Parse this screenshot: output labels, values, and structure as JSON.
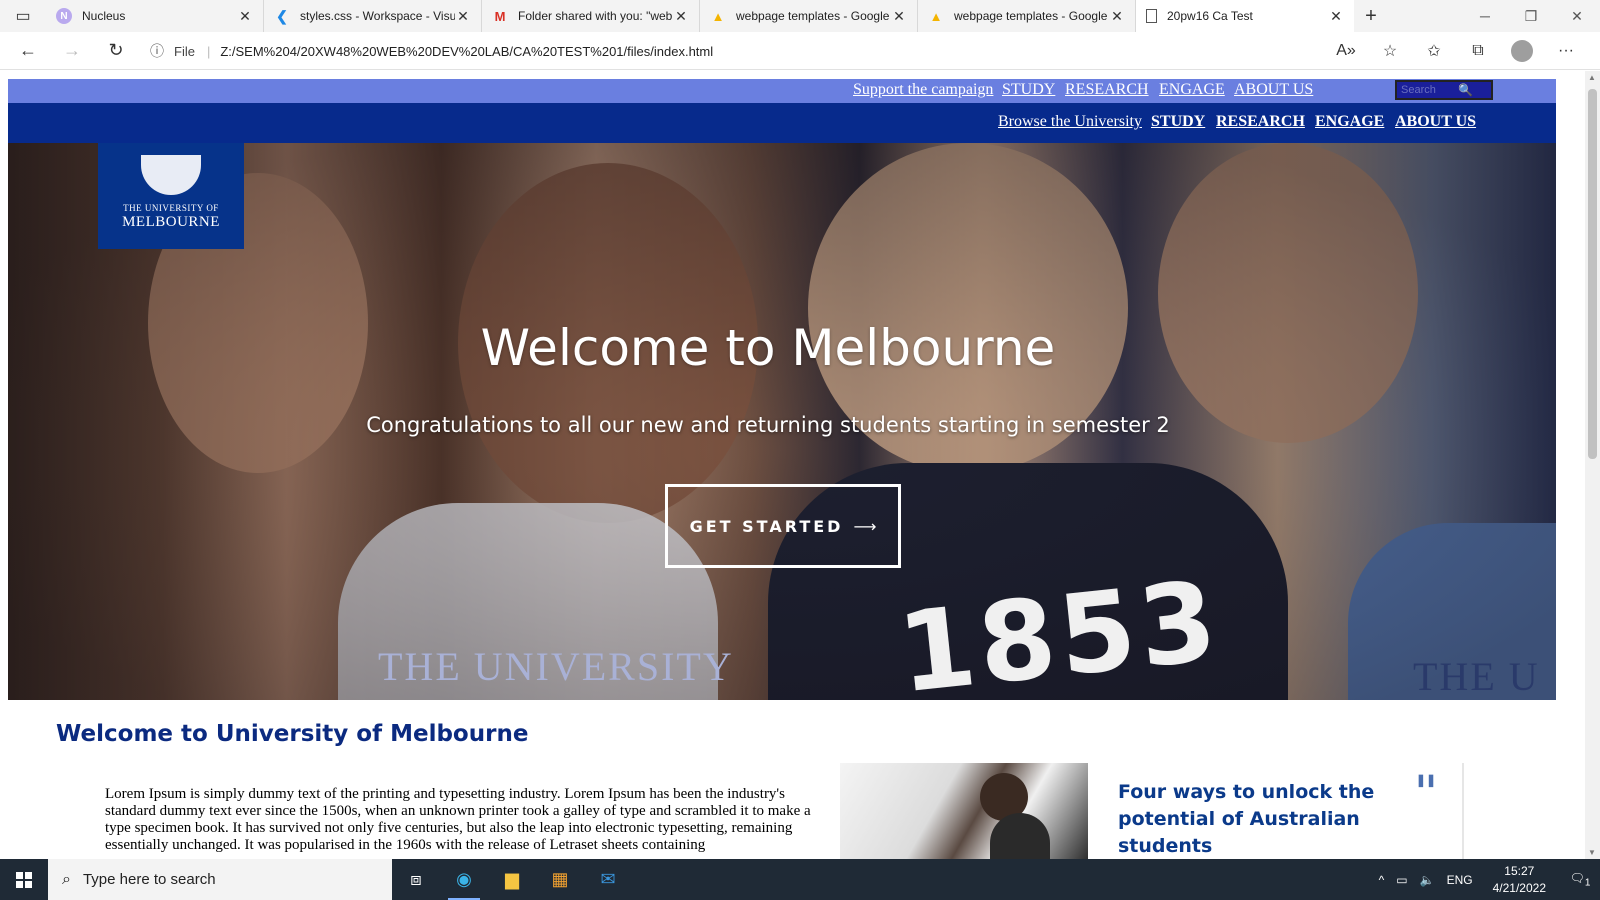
{
  "browser": {
    "tabs": [
      {
        "title": "Nucleus",
        "favicon": "N",
        "active": false
      },
      {
        "title": "styles.css - Workspace - Visua",
        "favicon": "vscode",
        "active": false
      },
      {
        "title": "Folder shared with you: \"web",
        "favicon": "M",
        "active": false
      },
      {
        "title": "webpage templates - Google",
        "favicon": "drive",
        "active": false
      },
      {
        "title": "webpage templates - Google",
        "favicon": "drive",
        "active": false
      },
      {
        "title": "20pw16 Ca Test",
        "favicon": "page",
        "active": true
      }
    ],
    "address": {
      "scheme_label": "File",
      "url": "Z:/SEM%204/20XW48%20WEB%20DEV%20LAB/CA%20TEST%201/files/index.html"
    }
  },
  "page": {
    "topnav": {
      "links": [
        "Support the campaign",
        "STUDY",
        "RESEARCH",
        "ENGAGE",
        "ABOUT US"
      ],
      "search_placeholder": "Search"
    },
    "mainnav": {
      "links": [
        "Browse the University",
        "STUDY",
        "RESEARCH",
        "ENGAGE",
        "ABOUT US"
      ]
    },
    "hero": {
      "logo_line1": "THE UNIVERSITY OF",
      "logo_line2": "MELBOURNE",
      "title": "Welcome to Melbourne",
      "subtitle": "Congratulations to all our new and returning students starting in semester 2",
      "cta": "GET STARTED",
      "cta_arrow": "⟶",
      "shirt_text_left": "THE UNIVERSITY",
      "shirt_text_right": "THE U",
      "shirt_number": "1853"
    },
    "welcome_heading": "Welcome to University of Melbourne",
    "lorem": "Lorem Ipsum is simply dummy text of the printing and typesetting industry. Lorem Ipsum has been the industry's standard dummy text ever since the 1500s, when an unknown printer took a galley of type and scrambled it to make a type specimen book. It has survived not only five centuries, but also the leap into electronic typesetting, remaining essentially unchanged. It was popularised in the 1960s with the release of Letraset sheets containing",
    "news": {
      "title": "Four ways to unlock the potential of Australian students",
      "pause_icon": "pause-icon"
    }
  },
  "taskbar": {
    "search_placeholder": "Type here to search",
    "language": "ENG",
    "time": "15:27",
    "date": "4/21/2022",
    "notifications": "1"
  },
  "colors": {
    "topnav_bg": "#6a7fe0",
    "mainnav_bg": "#072a8c",
    "heading_blue": "#0b2a80",
    "news_title": "#0b3a8a"
  }
}
